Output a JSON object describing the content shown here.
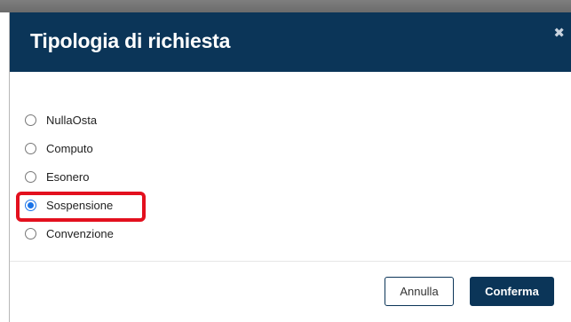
{
  "dialog": {
    "title": "Tipologia di richiesta",
    "close_icon": "close-icon",
    "options": [
      {
        "label": "NullaOsta",
        "checked": false
      },
      {
        "label": "Computo",
        "checked": false
      },
      {
        "label": "Esonero",
        "checked": false
      },
      {
        "label": "Sospensione",
        "checked": true
      },
      {
        "label": "Convenzione",
        "checked": false
      }
    ],
    "footer": {
      "cancel_label": "Annulla",
      "confirm_label": "Conferma"
    }
  },
  "colors": {
    "header_bg": "#0b3558",
    "highlight": "#e3101e",
    "radio_checked": "#1a73e8"
  }
}
